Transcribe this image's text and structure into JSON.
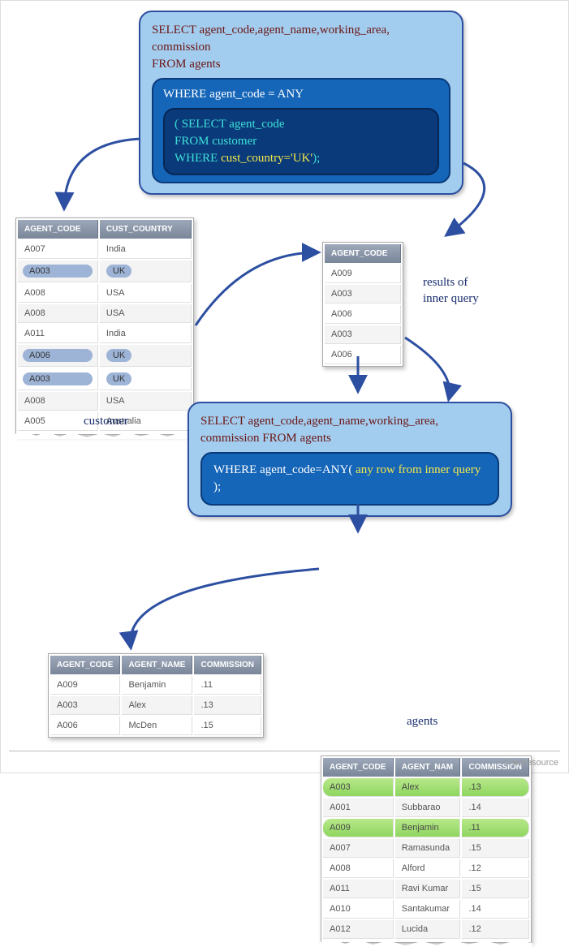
{
  "box1": {
    "line1a": "SELECT ",
    "line1b": "agent_code,agent_name,working_area,",
    "line2a": "commission",
    "line3a": "FROM ",
    "line3b": " agents",
    "inner_line": "WHERE agent_code = ANY",
    "deep_l1": "( SELECT agent_code",
    "deep_l2": "FROM customer",
    "deep_l3a": "WHERE ",
    "deep_l3b": "cust_country='UK'",
    "deep_l3c": ");"
  },
  "box2": {
    "line1a": "SELECT ",
    "line1b": "agent_code,agent_name,working_area,",
    "line2": "commission FROM  agents",
    "inner_a": "WHERE agent_code=ANY( ",
    "inner_b": "any row from inner query",
    "inner_c": " );"
  },
  "customer": {
    "caption": "customer",
    "h1": "AGENT_CODE",
    "h2": "CUST_COUNTRY",
    "rows": [
      {
        "c0": "A007",
        "c1": "India",
        "hl": false
      },
      {
        "c0": "A003",
        "c1": "UK",
        "hl": true
      },
      {
        "c0": "A008",
        "c1": "USA",
        "hl": false
      },
      {
        "c0": "A008",
        "c1": "USA",
        "hl": false
      },
      {
        "c0": "A011",
        "c1": "India",
        "hl": false
      },
      {
        "c0": "A006",
        "c1": "UK",
        "hl": true
      },
      {
        "c0": "A003",
        "c1": "UK",
        "hl": true
      },
      {
        "c0": "A008",
        "c1": "USA",
        "hl": false
      },
      {
        "c0": "A005",
        "c1": "Australia",
        "hl": false
      }
    ]
  },
  "inner_result": {
    "caption1": "results of",
    "caption2": "inner query",
    "h1": "AGENT_CODE",
    "rows": [
      "A009",
      "A003",
      "A006",
      "A003",
      "A006"
    ]
  },
  "agents": {
    "caption": "agents",
    "h1": "AGENT_CODE",
    "h2": "AGENT_NAM",
    "h3": "COMMISSION",
    "rows": [
      {
        "c0": "A003",
        "c1": "Alex",
        "c2": ".13",
        "hl": true
      },
      {
        "c0": "A001",
        "c1": "Subbarao",
        "c2": ".14",
        "hl": false
      },
      {
        "c0": "A009",
        "c1": "Benjamin",
        "c2": ".11",
        "hl": true
      },
      {
        "c0": "A007",
        "c1": "Ramasunda",
        "c2": ".15",
        "hl": false
      },
      {
        "c0": "A008",
        "c1": "Alford",
        "c2": ".12",
        "hl": false
      },
      {
        "c0": "A011",
        "c1": "Ravi Kumar",
        "c2": ".15",
        "hl": false
      },
      {
        "c0": "A010",
        "c1": "Santakumar",
        "c2": ".14",
        "hl": false
      },
      {
        "c0": "A012",
        "c1": "Lucida",
        "c2": ".12",
        "hl": false
      }
    ]
  },
  "final": {
    "h1": "AGENT_CODE",
    "h2": "AGENT_NAME",
    "h3": "COMMISSION",
    "rows": [
      {
        "c0": "A009",
        "c1": "Benjamin",
        "c2": ".11"
      },
      {
        "c0": "A003",
        "c1": "Alex",
        "c2": ".13"
      },
      {
        "c0": "A006",
        "c1": "McDen",
        "c2": ".15"
      }
    ]
  },
  "footer": "© w3resource"
}
